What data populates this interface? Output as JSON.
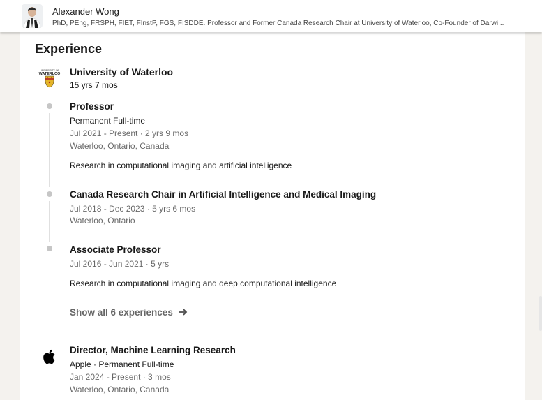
{
  "header": {
    "name": "Alexander Wong",
    "headline": "PhD, PEng, FRSPH, FIET, FInstP, FGS, FISDDE. Professor and Former Canada Research Chair at University of Waterloo, Co-Founder of Darwi..."
  },
  "section": {
    "title": "Experience"
  },
  "companies": [
    {
      "name": "University of Waterloo",
      "duration": "15 yrs 7 mos",
      "logo_text_top": "UNIVERSITY OF",
      "logo_text_main": "WATERLOO",
      "roles": [
        {
          "title": "Professor",
          "employment_type": "Permanent Full-time",
          "dates": "Jul 2021 - Present · 2 yrs 9 mos",
          "location": "Waterloo, Ontario, Canada",
          "description": "Research in computational imaging and artificial intelligence"
        },
        {
          "title": "Canada Research Chair in Artificial Intelligence and Medical Imaging",
          "dates": "Jul 2018 - Dec 2023 · 5 yrs 6 mos",
          "location": "Waterloo, Ontario"
        },
        {
          "title": "Associate Professor",
          "dates": "Jul 2016 - Jun 2021 · 5 yrs",
          "description": "Research in computational imaging and deep computational intelligence"
        }
      ],
      "show_all_label": "Show all 6 experiences"
    }
  ],
  "single_roles": [
    {
      "title": "Director, Machine Learning Research",
      "subtitle": "Apple · Permanent Full-time",
      "dates": "Jan 2024 - Present · 3 mos",
      "location": "Waterloo, Ontario, Canada"
    }
  ],
  "colors": {
    "page_bg": "#f4f2ee",
    "card_bg": "#ffffff",
    "timeline_dot": "#c6c6c6",
    "waterloo_gold": "#e4b429"
  }
}
